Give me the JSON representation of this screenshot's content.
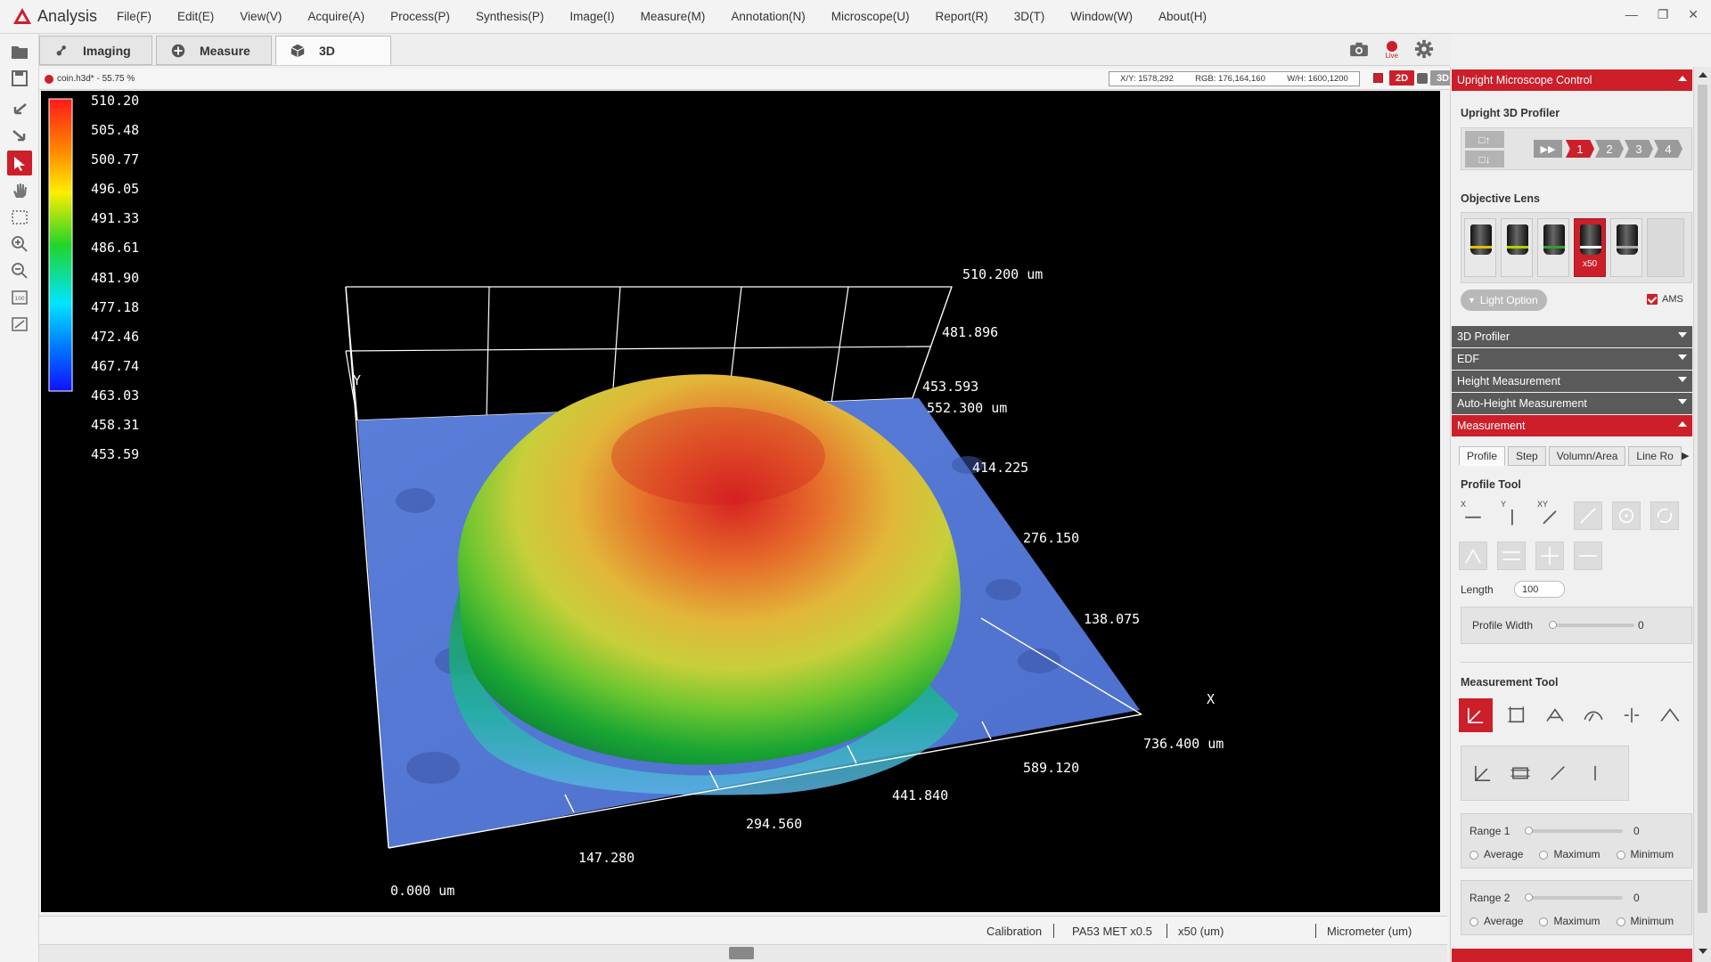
{
  "app": {
    "name": "Analysis",
    "menu": [
      "File(F)",
      "Edit(E)",
      "View(V)",
      "Acquire(A)",
      "Process(P)",
      "Synthesis(P)",
      "Image(I)",
      "Measure(M)",
      "Annotation(N)",
      "Microscope(U)",
      "Report(R)",
      "3D(T)",
      "Window(W)",
      "About(H)"
    ]
  },
  "tabs": [
    {
      "label": "Imaging",
      "icon": "imaging-icon"
    },
    {
      "label": "Measure",
      "icon": "measure-icon"
    },
    {
      "label": "3D",
      "icon": "cube-icon",
      "active": true
    }
  ],
  "toolbar_right": {
    "live_label": "Live"
  },
  "document": {
    "title": "coin.h3d* - 55.75 %",
    "readouts": {
      "xy": "X/Y: 1578,292",
      "rgb": "RGB: 176,164,160",
      "wh": "W/H: 1600,1200"
    },
    "mode_2d": "2D",
    "mode_3d": "3D"
  },
  "colorbar": {
    "labels": [
      "510.20",
      "505.48",
      "500.77",
      "496.05",
      "491.33",
      "486.61",
      "481.90",
      "477.18",
      "472.46",
      "467.74",
      "463.03",
      "458.31",
      "453.59"
    ]
  },
  "plot3d": {
    "z_labels": [
      "510.200 um",
      "481.896",
      "453.593"
    ],
    "y_labels": [
      "552.300 um",
      "414.225",
      "276.150",
      "138.075"
    ],
    "x_labels": [
      "0.000 um",
      "147.280",
      "294.560",
      "441.840",
      "589.120",
      "736.400 um"
    ],
    "axis_x": "X",
    "axis_y": "Y"
  },
  "status": {
    "calibration": "Calibration",
    "objective": "PA53 MET x0.5",
    "magnification": "x50 (um)",
    "unit": "Micrometer (um)"
  },
  "panel": {
    "header": "Upright Microscope Control",
    "profiler_title": "Upright 3D Profiler",
    "steps": [
      "1",
      "2",
      "3",
      "4"
    ],
    "objective_title": "Objective Lens",
    "selected_lens_label": "x50",
    "light_option": "Light Option",
    "ams_label": "AMS",
    "sections": [
      "3D Profiler",
      "EDF",
      "Height Measurement",
      "Auto-Height Measurement"
    ],
    "measurement_header": "Measurement",
    "sub_tabs": [
      "Profile",
      "Step",
      "Volumn/Area",
      "Line Ro"
    ],
    "profile_tool_title": "Profile Tool",
    "profile_tool_letters": [
      "X",
      "Y",
      "XY"
    ],
    "length_label": "Length",
    "length_value": "100",
    "profile_width_label": "Profile Width",
    "profile_width_value": "0",
    "measurement_tool_title": "Measurement Tool",
    "range1_label": "Range 1",
    "range1_value": "0",
    "range2_label": "Range 2",
    "range2_value": "0",
    "radio_options": [
      "Average",
      "Maximum",
      "Minimum"
    ]
  },
  "colors": {
    "accent": "#cc1f2a",
    "viewport_bg": "#000000",
    "section_gray": "#5a5a5a"
  }
}
